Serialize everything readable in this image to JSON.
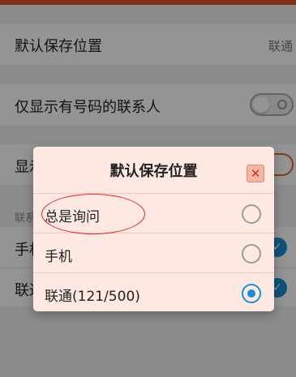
{
  "settings": {
    "default_location_label": "默认保存位置",
    "default_location_value": "联通",
    "show_with_number_label": "仅显示有号码的联系人",
    "show_with_number_on": false,
    "row3_label_partial": "显示",
    "row3_toggle_on": true,
    "section_title_partial": "联系",
    "phone_row_partial": "手机",
    "unicom_row_partial": "联通"
  },
  "dialog": {
    "title": "默认保存位置",
    "close_glyph": "✕",
    "options": [
      {
        "label": "总是询问",
        "selected": false
      },
      {
        "label": "手机",
        "selected": false
      },
      {
        "label": "联通(121/500)",
        "selected": true
      }
    ]
  },
  "colors": {
    "accent_toggle": "#e0622b",
    "radio_selected": "#1a8fd6",
    "annotation": "#e0242a",
    "dialog_bg": "#fde9e1"
  }
}
